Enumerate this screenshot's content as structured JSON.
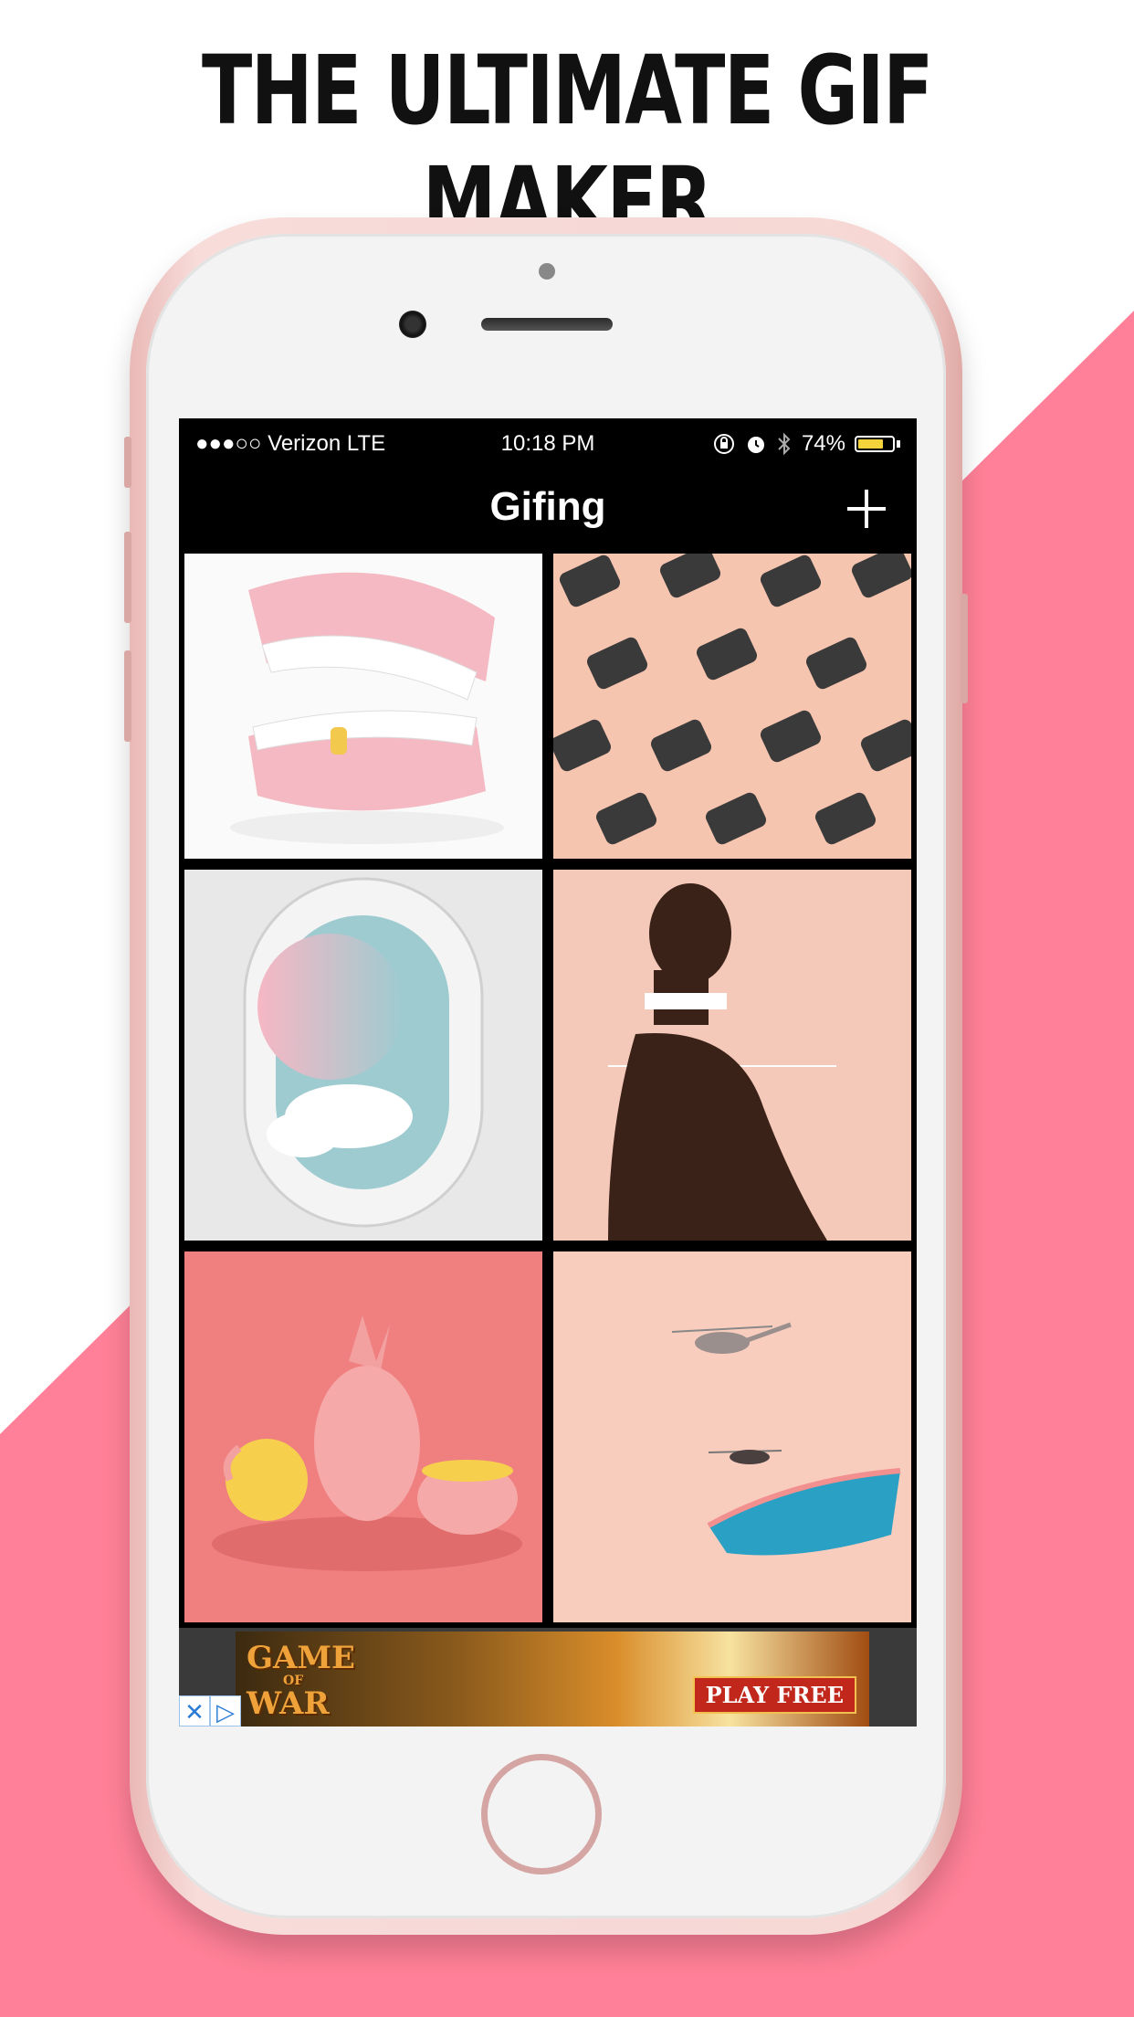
{
  "headline": "THE ULTIMATE  GIF MAKER",
  "status_bar": {
    "carrier": "●●●○○ Verizon   LTE",
    "time": "10:18 PM",
    "battery_percent": "74%",
    "battery_level": 0.74,
    "icons": [
      "rotation-lock-icon",
      "alarm-icon",
      "bluetooth-icon",
      "battery-icon"
    ]
  },
  "nav": {
    "title": "Gifing",
    "add_icon": "plus-icon"
  },
  "gifs": [
    {
      "subject": "teeth"
    },
    {
      "subject": "chairs"
    },
    {
      "subject": "airplane-window"
    },
    {
      "subject": "man-profile"
    },
    {
      "subject": "pineapple"
    },
    {
      "subject": "helicopter-pool"
    }
  ],
  "ad": {
    "title_line1": "GAME",
    "title_line2": "OF",
    "title_line3": "WAR",
    "cta": "PLAY FREE",
    "close_glyph": "✕",
    "adchoices_glyph": "▷"
  },
  "colors": {
    "accent_pink": "#ff8098",
    "phone_rose_gold": "#f6d7d4",
    "battery": "#f5d33b"
  }
}
